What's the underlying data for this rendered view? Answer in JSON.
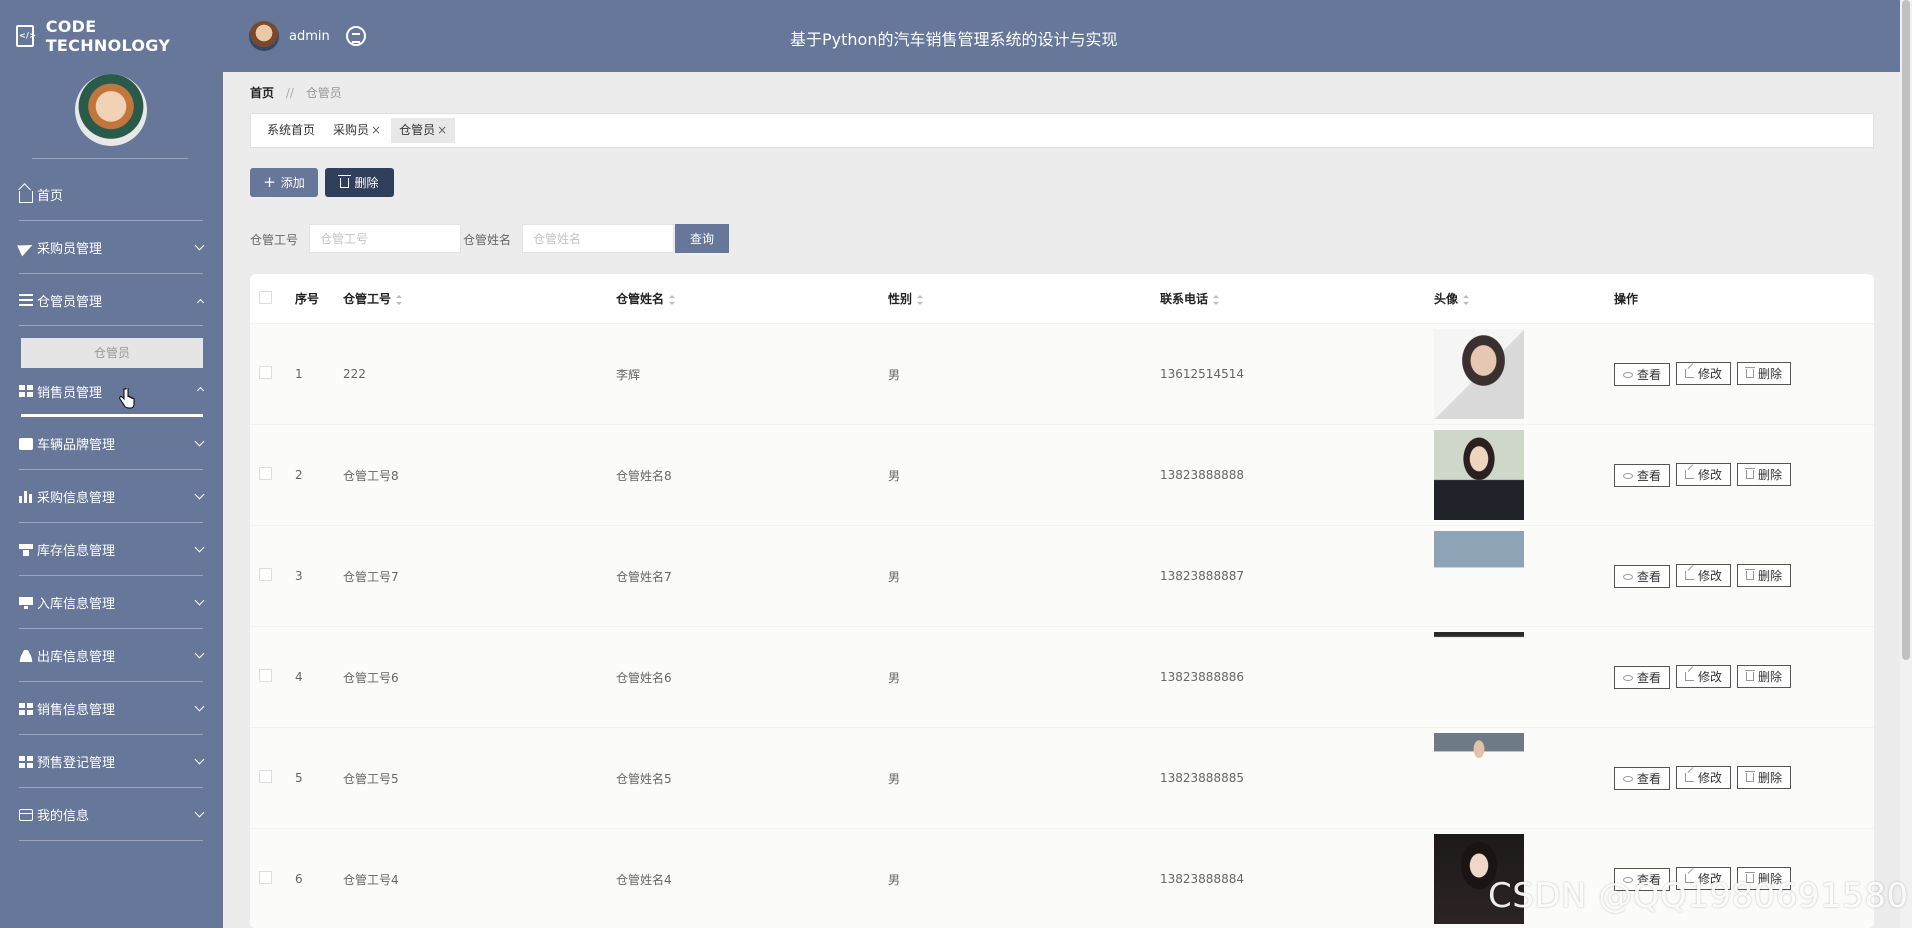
{
  "header": {
    "brand": "CODE TECHNOLOGY",
    "username": "admin",
    "system_title": "基于Python的汽车销售管理系统的设计与实现"
  },
  "sidebar": {
    "items": [
      {
        "label": "首页",
        "icon": "home-icon"
      },
      {
        "label": "采购员管理",
        "icon": "paper-plane-icon"
      },
      {
        "label": "仓管员管理",
        "icon": "list-icon",
        "expanded": true
      },
      {
        "label": "销售员管理",
        "icon": "grid-icon"
      },
      {
        "label": "车辆品牌管理",
        "icon": "chat-icon"
      },
      {
        "label": "采购信息管理",
        "icon": "bar-chart-icon"
      },
      {
        "label": "库存信息管理",
        "icon": "store-icon"
      },
      {
        "label": "入库信息管理",
        "icon": "monitor-icon"
      },
      {
        "label": "出库信息管理",
        "icon": "user-icon"
      },
      {
        "label": "销售信息管理",
        "icon": "grid-icon"
      },
      {
        "label": "预售登记管理",
        "icon": "grid-icon"
      },
      {
        "label": "我的信息",
        "icon": "card-icon"
      }
    ],
    "submenu_active": "仓管员"
  },
  "breadcrumb": {
    "home": "首页",
    "separator": "//",
    "current": "仓管员"
  },
  "tabs": [
    {
      "label": "系统首页",
      "closable": false
    },
    {
      "label": "采购员",
      "closable": true
    },
    {
      "label": "仓管员",
      "closable": true,
      "active": true
    }
  ],
  "toolbar": {
    "add_label": "添加",
    "delete_label": "删除"
  },
  "filters": {
    "id_label": "仓管工号",
    "id_placeholder": "仓管工号",
    "name_label": "仓管姓名",
    "name_placeholder": "仓管姓名",
    "query_label": "查询"
  },
  "table": {
    "headers": {
      "no": "序号",
      "id": "仓管工号",
      "name": "仓管姓名",
      "sex": "性别",
      "tel": "联系电话",
      "img": "头像",
      "op": "操作"
    },
    "rows": [
      {
        "no": "1",
        "id": "222",
        "name": "李辉",
        "sex": "男",
        "tel": "13612514514"
      },
      {
        "no": "2",
        "id": "仓管工号8",
        "name": "仓管姓名8",
        "sex": "男",
        "tel": "13823888888"
      },
      {
        "no": "3",
        "id": "仓管工号7",
        "name": "仓管姓名7",
        "sex": "男",
        "tel": "13823888887"
      },
      {
        "no": "4",
        "id": "仓管工号6",
        "name": "仓管姓名6",
        "sex": "男",
        "tel": "13823888886"
      },
      {
        "no": "5",
        "id": "仓管工号5",
        "name": "仓管姓名5",
        "sex": "男",
        "tel": "13823888885"
      },
      {
        "no": "6",
        "id": "仓管工号4",
        "name": "仓管姓名4",
        "sex": "男",
        "tel": "13823888884"
      }
    ],
    "actions": {
      "view": "查看",
      "edit": "修改",
      "delete": "删除"
    }
  },
  "watermark": "CSDN @QQ1980691580",
  "colors": {
    "primary": "#667799",
    "dark": "#2f3f5c",
    "background": "#ececec"
  }
}
